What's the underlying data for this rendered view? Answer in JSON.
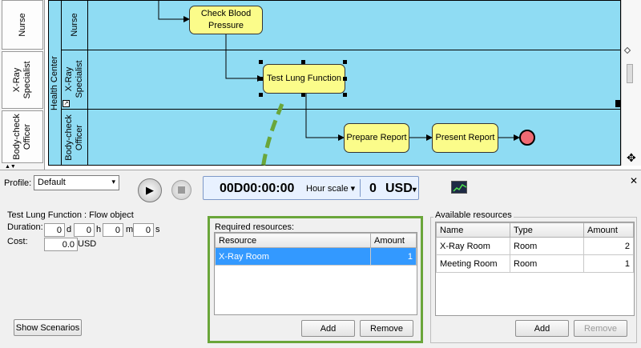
{
  "diagram": {
    "lanes": [
      {
        "tab": "Nurse",
        "label": "Nurse"
      },
      {
        "tab": "X-Ray Specialist",
        "label": "X-Ray Specialist"
      },
      {
        "tab": "Body-check Officer",
        "label": "Body-check Officer"
      }
    ],
    "pool_label": "Health Center",
    "nodes": {
      "check_bp": "Check Blood Pressure",
      "test_lung": "Test Lung Function",
      "prepare_report": "Prepare Report",
      "present_report": "Present Report"
    },
    "colors": {
      "pool": "#8fdcf3",
      "task": "#fbfc8a",
      "end_event": "#f06a73",
      "callout_arrow": "#6aa63a"
    }
  },
  "controls": {
    "profile_label": "Profile:",
    "profile_value": "Default",
    "clock_time": "00D00:00:00",
    "scale_label": "Hour scale",
    "cost_value": "0",
    "cost_currency": "USD"
  },
  "flow_object": {
    "title": "Test Lung Function : Flow object",
    "duration_label": "Duration:",
    "duration_d": "0",
    "duration_h": "0",
    "duration_m": "0",
    "duration_s": "0",
    "unit_d": "d",
    "unit_h": "h",
    "unit_m": "m",
    "unit_s": "s",
    "cost_label": "Cost:",
    "cost_value": "0.0",
    "cost_unit": "USD",
    "show_scenarios": "Show Scenarios"
  },
  "required": {
    "title": "Required resources:",
    "columns": [
      "Resource",
      "Amount"
    ],
    "rows": [
      {
        "resource": "X-Ray Room",
        "amount": "1"
      }
    ],
    "add": "Add",
    "remove": "Remove"
  },
  "available": {
    "title": "Available resources",
    "columns": [
      "Name",
      "Type",
      "Amount"
    ],
    "rows": [
      {
        "name": "X-Ray Room",
        "type": "Room",
        "amount": "2"
      },
      {
        "name": "Meeting Room",
        "type": "Room",
        "amount": "1"
      }
    ],
    "add": "Add",
    "remove": "Remove"
  }
}
